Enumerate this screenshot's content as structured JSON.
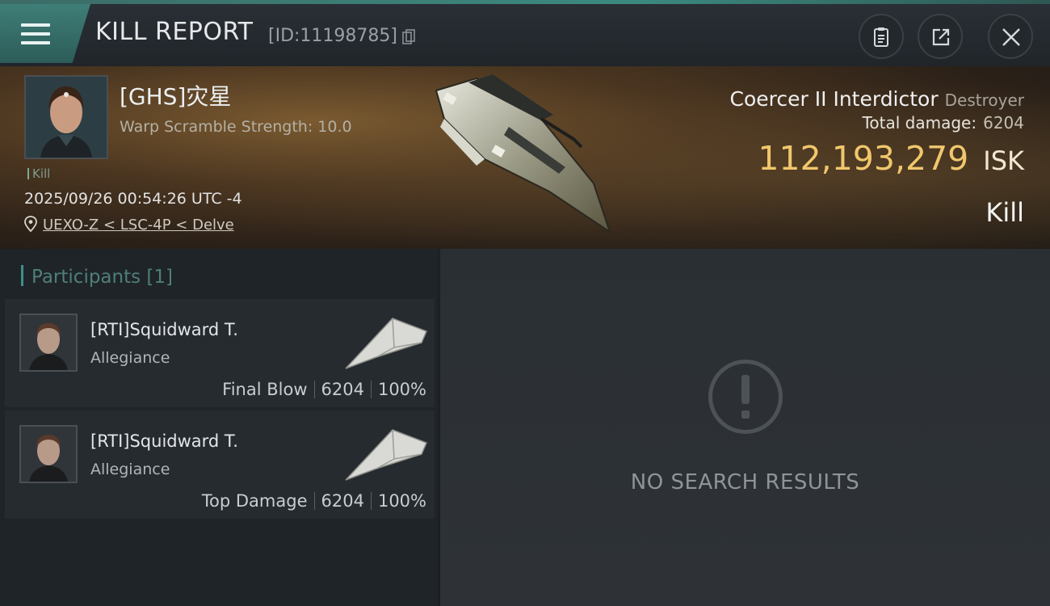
{
  "header": {
    "title": "KILL REPORT",
    "report_id": "[ID:11198785]",
    "icons": [
      "menu-icon",
      "copy-icon",
      "clipboard-icon",
      "share-icon",
      "close-icon"
    ]
  },
  "victim": {
    "name": "[GHS]灾星",
    "warp_scramble": "Warp Scramble Strength: 10.0",
    "tag": "Kill",
    "timestamp": "2025/09/26 00:54:26 UTC -4",
    "location": "UEXO-Z < LSC-4P < Delve"
  },
  "ship": {
    "name": "Coercer II Interdictor",
    "class": "Destroyer",
    "total_damage_label": "Total damage:",
    "total_damage": "6204",
    "isk_value": "112,193,279",
    "isk_unit": "ISK",
    "result": "Kill"
  },
  "participants": {
    "header": "Participants [1]",
    "rows": [
      {
        "name": "[RTI]Squidward T.",
        "alliance": "Allegiance",
        "role": "Final Blow",
        "damage": "6204",
        "percent": "100%"
      },
      {
        "name": "[RTI]Squidward T.",
        "alliance": "Allegiance",
        "role": "Top Damage",
        "damage": "6204",
        "percent": "100%"
      }
    ]
  },
  "results": {
    "empty_text": "NO SEARCH RESULTS"
  },
  "colors": {
    "accent": "#3f8f86",
    "isk": "#f0c76c"
  }
}
